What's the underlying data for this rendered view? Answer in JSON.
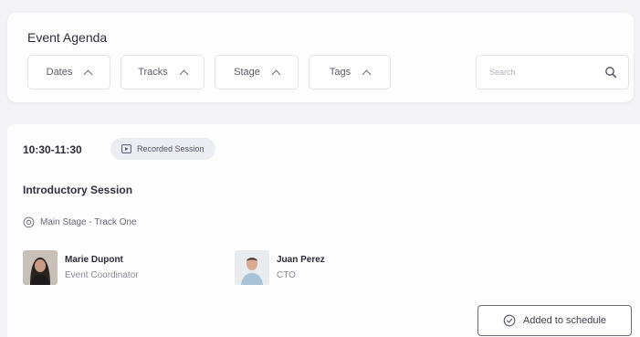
{
  "header": {
    "title": "Event Agenda",
    "filters": [
      {
        "label": "Dates",
        "icon": "chevron-up-icon"
      },
      {
        "label": "Tracks",
        "icon": "chevron-up-icon"
      },
      {
        "label": "Stage",
        "icon": "chevron-up-icon"
      },
      {
        "label": "Tags",
        "icon": "chevron-up-icon"
      }
    ],
    "search": {
      "placeholder": "Search",
      "value": "",
      "icon": "search-icon"
    }
  },
  "session": {
    "time": "10:30-11:30",
    "badge": "Recorded Session",
    "title": "Introductory Session",
    "location": "Main Stage - Track One",
    "speakers": [
      {
        "name": "Marie Dupont",
        "role": "Event Coordinator"
      },
      {
        "name": "Juan Perez",
        "role": "CTO"
      }
    ],
    "schedule_button": "Added to schedule"
  },
  "colors": {
    "background": "#f3f3f5",
    "card": "#fdfdfd",
    "badge_bg": "#ececf3",
    "text_primary": "#2b2b38",
    "text_muted": "#8b8b98"
  }
}
